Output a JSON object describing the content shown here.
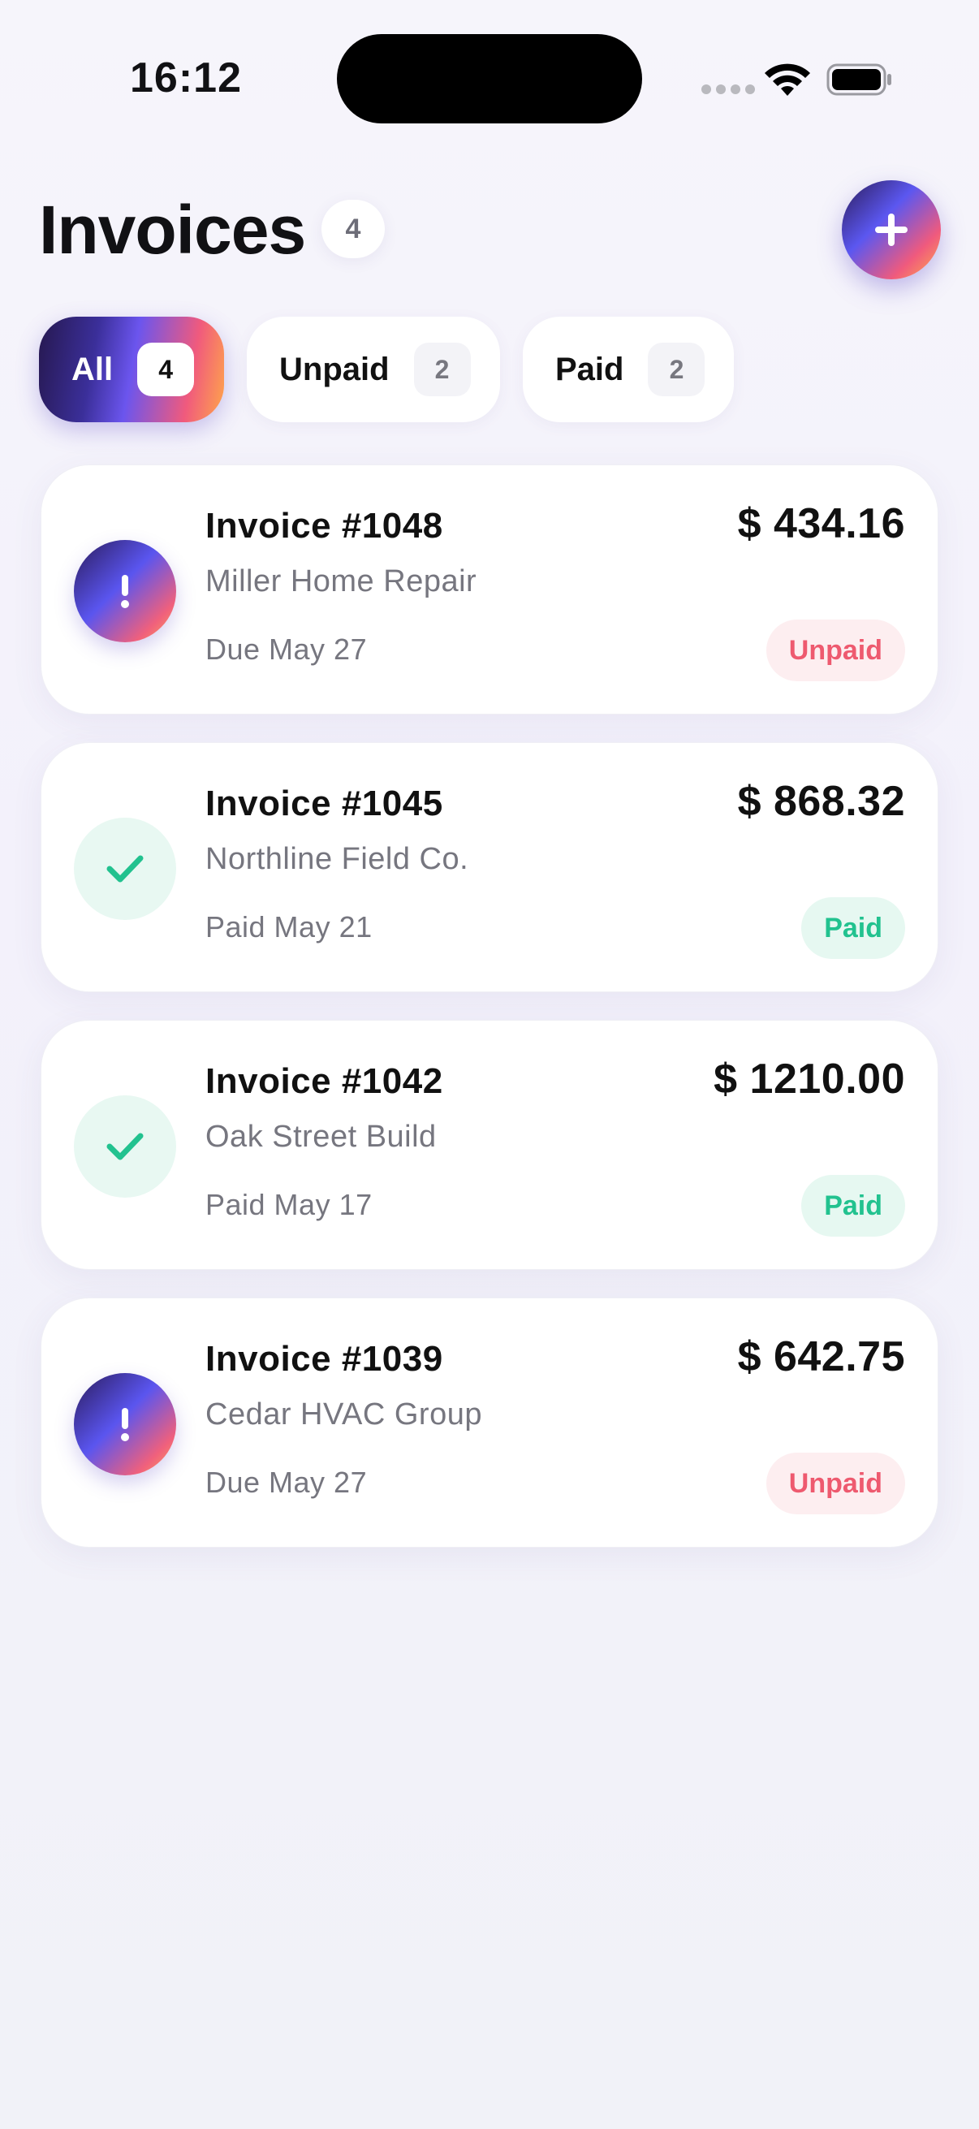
{
  "status_bar": {
    "time": "16:12"
  },
  "header": {
    "title": "Invoices",
    "count": "4"
  },
  "add_button": {
    "icon": "plus-icon"
  },
  "tabs": [
    {
      "label": "All",
      "count": "4",
      "active": true
    },
    {
      "label": "Unpaid",
      "count": "2",
      "active": false
    },
    {
      "label": "Paid",
      "count": "2",
      "active": false
    }
  ],
  "invoices": [
    {
      "title": "Invoice #1048",
      "client": "Miller Home Repair",
      "date": "Due May 27",
      "amount": "$ 434.16",
      "status": "Unpaid",
      "icon": "exclamation-icon"
    },
    {
      "title": "Invoice #1045",
      "client": "Northline Field Co.",
      "date": "Paid May 21",
      "amount": "$ 868.32",
      "status": "Paid",
      "icon": "checkmark-icon"
    },
    {
      "title": "Invoice #1042",
      "client": "Oak Street Build",
      "date": "Paid May 17",
      "amount": "$ 1210.00",
      "status": "Paid",
      "icon": "checkmark-icon"
    },
    {
      "title": "Invoice #1039",
      "client": "Cedar HVAC Group",
      "date": "Due May 27",
      "amount": "$ 642.75",
      "status": "Unpaid",
      "icon": "exclamation-icon"
    }
  ],
  "colors": {
    "unpaid": "#ee5a6f",
    "paid": "#22c28f",
    "accent": "#5b57f0"
  }
}
